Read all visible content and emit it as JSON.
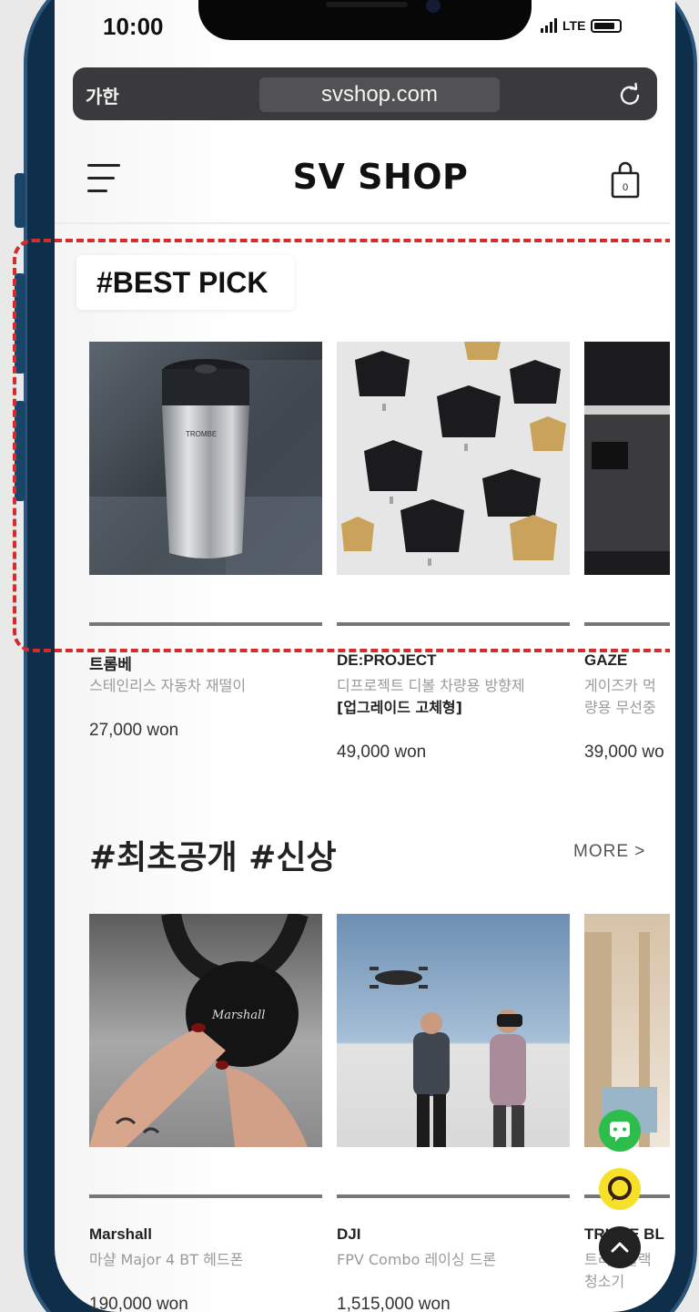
{
  "status_bar": {
    "time": "10:00",
    "network": "LTE"
  },
  "browser": {
    "text_size_label": "가한",
    "url": "svshop.com"
  },
  "header": {
    "logo": "SV SHOP",
    "cart_count": "0"
  },
  "best_pick": {
    "title": "#BEST PICK",
    "products": [
      {
        "brand": "트롬베",
        "desc": "스테인리스 자동차 재떨이",
        "desc2": "",
        "price": "27,000 won"
      },
      {
        "brand": "DE:PROJECT",
        "desc": "디프로젝트 디볼 차량용 방향제",
        "desc2": "[업그레이드 고체형]",
        "price": "49,000 won"
      },
      {
        "brand": "GAZE",
        "desc": "게이즈카 먹",
        "desc2": "량용 무선중",
        "price": "39,000 wo"
      }
    ]
  },
  "new_arrivals": {
    "title": "#최초공개 #신상",
    "more_label": "MORE  >",
    "products": [
      {
        "brand": "Marshall",
        "desc": "마샬 Major 4 BT 헤드폰",
        "price": "190,000 won"
      },
      {
        "brand": "DJI",
        "desc": "FPV Combo 레이싱 드론",
        "price": "1,515,000 won"
      },
      {
        "brand": "TRIPLE BL",
        "desc": "트리플블랙",
        "desc2": "청소기"
      }
    ]
  },
  "colors": {
    "accent_red": "#d42b2b",
    "frame_navy": "#0f2e49",
    "chat_green": "#2dbd4a",
    "talk_yellow": "#f7e02a"
  },
  "icons": [
    "menu-icon",
    "shopping-bag-icon",
    "reload-icon",
    "chat-icon",
    "talk-icon",
    "scroll-top-icon"
  ]
}
